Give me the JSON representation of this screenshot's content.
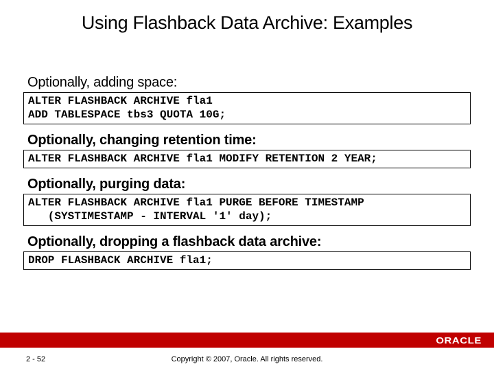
{
  "title": "Using Flashback Data Archive: Examples",
  "sections": [
    {
      "label": "Optionally, adding space:",
      "bold": false,
      "code": "ALTER FLASHBACK ARCHIVE fla1\nADD TABLESPACE tbs3 QUOTA 10G;"
    },
    {
      "label": "Optionally, changing retention time:",
      "bold": true,
      "code": "ALTER FLASHBACK ARCHIVE fla1 MODIFY RETENTION 2 YEAR;"
    },
    {
      "label": "Optionally, purging data:",
      "bold": true,
      "code": "ALTER FLASHBACK ARCHIVE fla1 PURGE BEFORE TIMESTAMP\n   (SYSTIMESTAMP - INTERVAL '1' day);"
    },
    {
      "label": "Optionally, dropping a flashback data archive:",
      "bold": true,
      "code": "DROP FLASHBACK ARCHIVE fla1;"
    }
  ],
  "footer": {
    "page": "2 - 52",
    "copyright": "Copyright © 2007, Oracle. All rights reserved.",
    "logo": "ORACLE"
  }
}
